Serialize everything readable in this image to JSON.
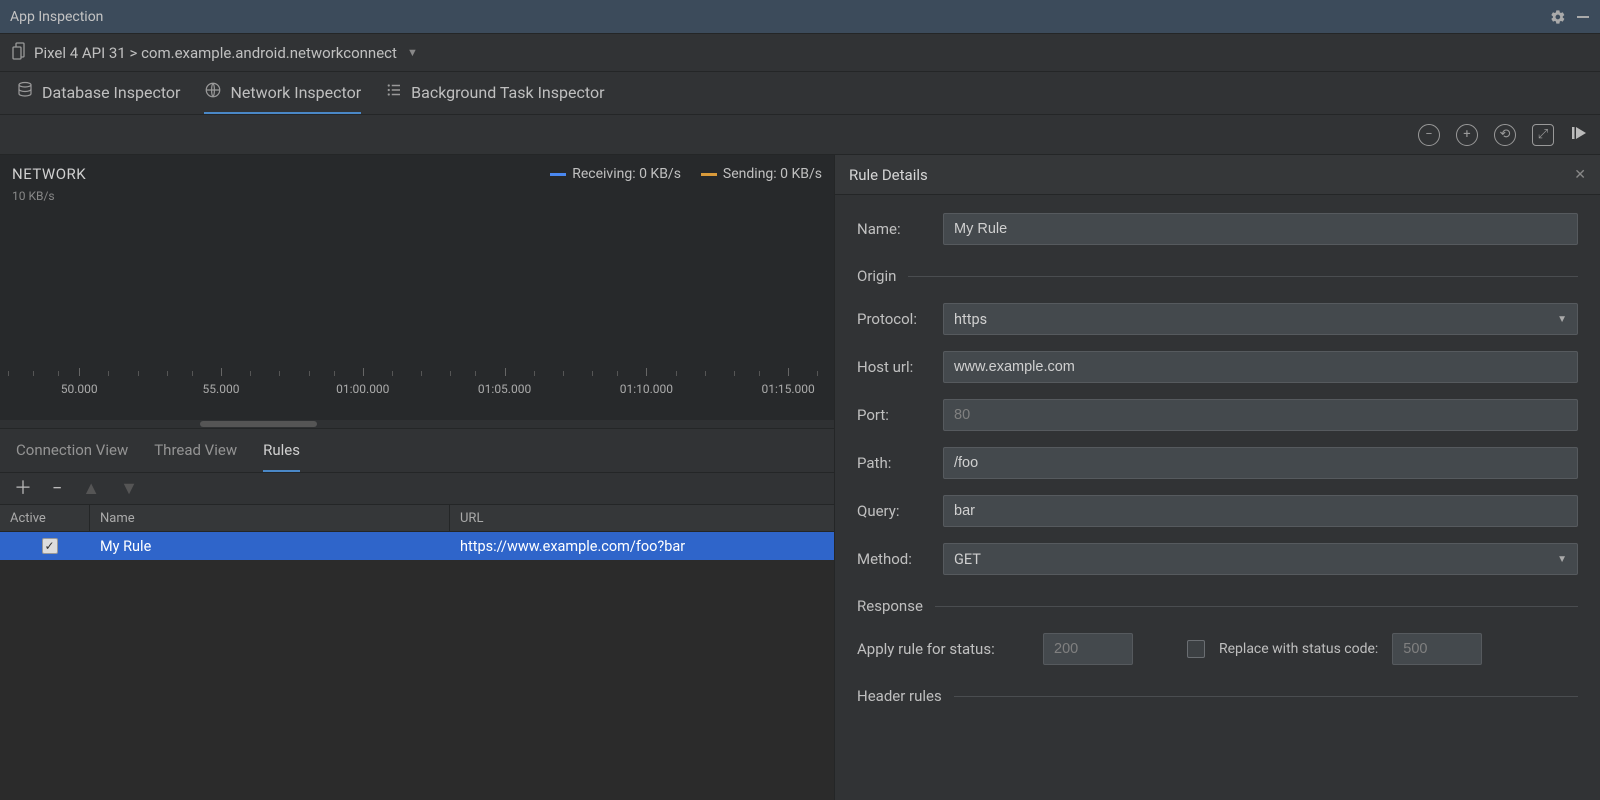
{
  "titleBar": {
    "title": "App Inspection"
  },
  "breadcrumb": {
    "text": "Pixel 4 API 31 > com.example.android.networkconnect"
  },
  "inspectorTabs": {
    "database": "Database Inspector",
    "network": "Network Inspector",
    "background": "Background Task Inspector"
  },
  "network": {
    "title": "NETWORK",
    "yLabel": "10 KB/s",
    "legend": {
      "receiving": "Receiving: 0 KB/s",
      "sending": "Sending: 0 KB/s"
    },
    "ticks": [
      "50.000",
      "55.000",
      "01:00.000",
      "01:05.000",
      "01:10.000",
      "01:15.000"
    ]
  },
  "subTabs": {
    "connection": "Connection View",
    "thread": "Thread View",
    "rules": "Rules"
  },
  "rulesTable": {
    "headers": {
      "active": "Active",
      "name": "Name",
      "url": "URL"
    },
    "row": {
      "active": true,
      "name": "My Rule",
      "url": "https://www.example.com/foo?bar"
    }
  },
  "details": {
    "title": "Rule Details",
    "name": {
      "label": "Name:",
      "value": "My Rule"
    },
    "sections": {
      "origin": "Origin",
      "response": "Response",
      "headerRules": "Header rules"
    },
    "protocol": {
      "label": "Protocol:",
      "value": "https"
    },
    "host": {
      "label": "Host url:",
      "value": "www.example.com"
    },
    "port": {
      "label": "Port:",
      "placeholder": "80"
    },
    "path": {
      "label": "Path:",
      "value": "/foo"
    },
    "query": {
      "label": "Query:",
      "value": "bar"
    },
    "method": {
      "label": "Method:",
      "value": "GET"
    },
    "applyStatus": {
      "label": "Apply rule for status:",
      "placeholder": "200"
    },
    "replaceStatus": {
      "label": "Replace with status code:",
      "placeholder": "500"
    }
  },
  "colors": {
    "receiving": "#4a88f0",
    "sending": "#d99a3a"
  }
}
